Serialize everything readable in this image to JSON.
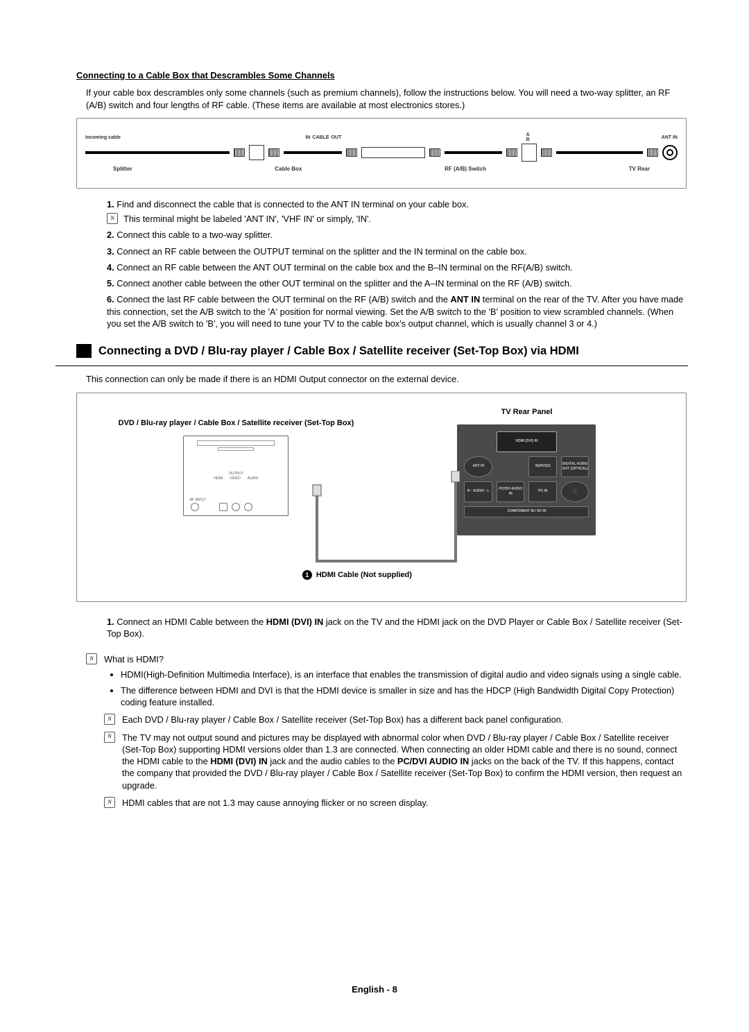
{
  "subheading": "Connecting to a Cable Box that Descrambles Some Channels",
  "intro": "If your cable box descrambles only some channels (such as premium channels), follow the instructions below. You will need a two-way splitter, an RF (A/B) switch and four lengths of RF cable. (These items are available at most electronics stores.)",
  "rf_diagram": {
    "incoming_cable": "Incoming cable",
    "splitter": "Splitter",
    "cable_box": "Cable Box",
    "in": "IN",
    "cable": "CABLE",
    "out": "OUT",
    "rf_switch": "RF (A/B) Switch",
    "ant_in": "ANT IN",
    "tv_rear": "TV Rear",
    "a": "A",
    "b": "B"
  },
  "steps": [
    {
      "text": "Find and disconnect the cable that is connected to the ANT IN terminal on your cable box.",
      "note": "This terminal might be labeled 'ANT IN', 'VHF IN' or simply, 'IN'."
    },
    {
      "text": "Connect this cable to a two-way splitter."
    },
    {
      "text": "Connect an RF cable between the OUTPUT terminal on the splitter and the IN terminal on the cable box."
    },
    {
      "text": "Connect an RF cable between the ANT OUT terminal on the cable box and the B–IN terminal on the RF(A/B) switch."
    },
    {
      "text": "Connect another cable between the other OUT terminal on the splitter and the A–IN terminal on the RF (A/B) switch."
    },
    {
      "text_start": "Connect the last RF cable between the OUT terminal on the RF (A/B) switch and the ",
      "bold1": "ANT IN",
      "text_end": " terminal on the rear of the TV. After you have made this connection, set the A/B switch to the 'A' position for normal viewing. Set the A/B switch to the 'B' position to view scrambled channels. (When you set the A/B switch to 'B', you will need to tune your TV to the cable box's output channel, which is usually channel 3 or 4.)"
    }
  ],
  "section_title": "Connecting a DVD / Blu-ray player / Cable Box / Satellite receiver (Set-Top Box) via HDMI",
  "section_intro": "This connection can only be made if there is an HDMI Output connector on the external device.",
  "hdmi_diagram": {
    "tv_rear_panel": "TV Rear Panel",
    "device_label": "DVD / Blu-ray player / Cable Box / Satellite receiver (Set-Top Box)",
    "cable_label": "HDMI Cable (Not supplied)",
    "cable_num": "1",
    "device_ports": {
      "output": "OUTPUT",
      "hdmi": "HDMI",
      "video": "VIDEO",
      "audio": "AUDIO",
      "rf_input": "RF INPUT"
    },
    "tv_ports": {
      "hdmi_dvi_in": "HDMI (DVI) IN",
      "ant_in": "ANT IN",
      "service": "SERVICE",
      "digital_audio_out": "DIGITAL AUDIO OUT (OPTICAL)",
      "pc_dvi_audio_in": "PC/DVI AUDIO IN",
      "pc_in": "PC IN",
      "audio_lr": "R - AUDIO - L",
      "component": "COMPONENT IN / AV IN",
      "headphone": "🎧"
    }
  },
  "hdmi_steps": [
    {
      "pre": "Connect an HDMI Cable between the ",
      "bold": "HDMI (DVI) IN",
      "post": " jack on the TV and the HDMI jack on the DVD Player or Cable Box / Satellite receiver (Set-Top Box)."
    }
  ],
  "note_what": "What is HDMI?",
  "bullets": [
    "HDMI(High-Definition Multimedia Interface), is an interface that enables the transmission of digital audio and video signals using a single cable.",
    "The difference between HDMI and DVI is that the HDMI device is smaller in size and has the HDCP (High Bandwidth Digital Copy Protection) coding feature installed."
  ],
  "sub_notes": [
    {
      "text": "Each DVD / Blu-ray player / Cable Box / Satellite receiver (Set-Top Box) has a different back panel configuration."
    },
    {
      "pre": "The TV may not output sound and pictures may be displayed with abnormal color when DVD / Blu-ray player / Cable Box / Satellite receiver (Set-Top Box) supporting HDMI versions older than 1.3 are connected. When connecting an older HDMI cable and there is no sound, connect the HDMI cable to the ",
      "bold1": "HDMI (DVI) IN",
      "mid": " jack and the audio cables to the ",
      "bold2": "PC/DVI AUDIO IN",
      "post": " jacks on the back of the TV. If this happens, contact the company that provided the DVD / Blu-ray player / Cable Box / Satellite receiver (Set-Top Box) to confirm the HDMI version, then request an upgrade."
    },
    {
      "text": "HDMI cables that are not 1.3 may cause annoying flicker or no screen display."
    }
  ],
  "footer": "English - 8"
}
